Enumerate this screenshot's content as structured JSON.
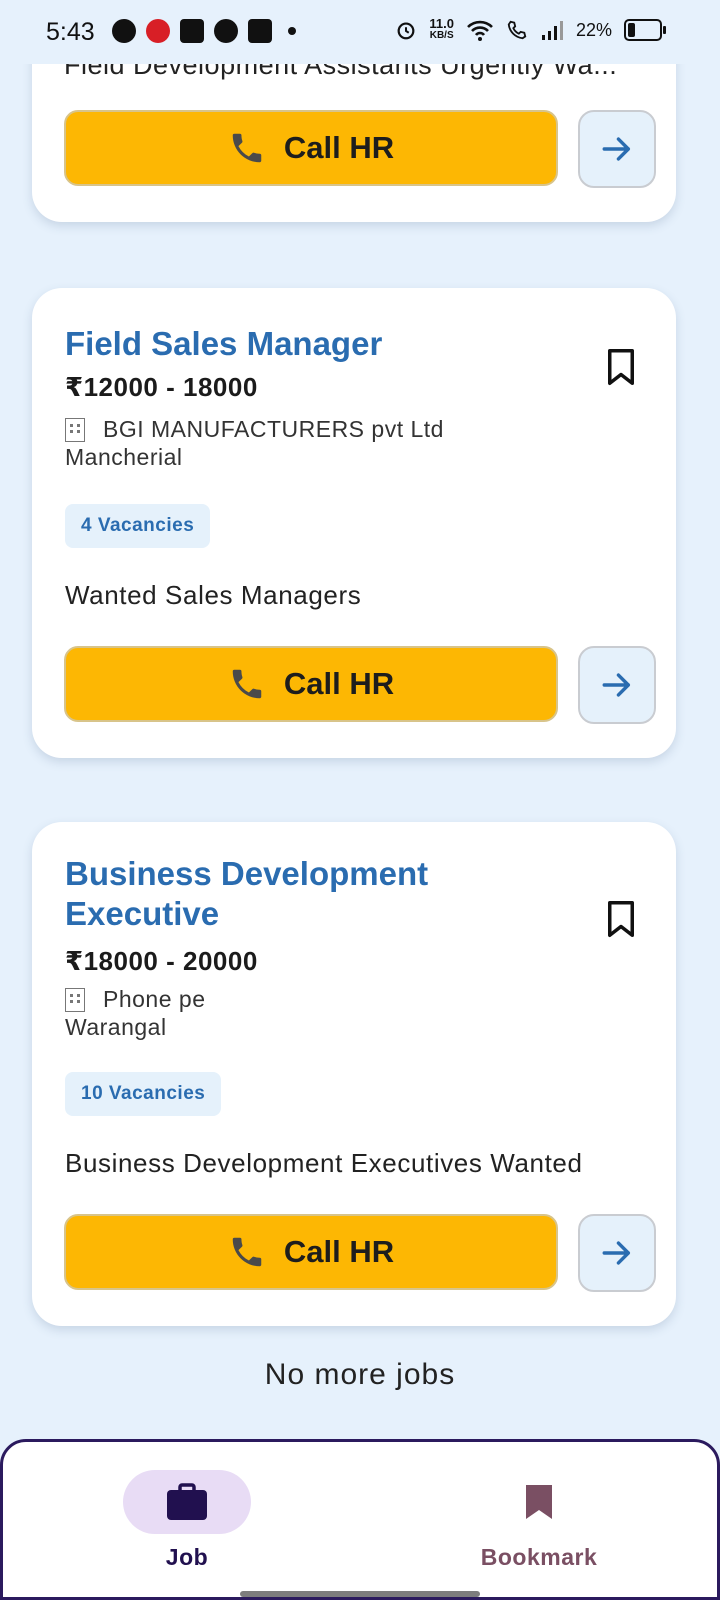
{
  "status_bar": {
    "time": "5:43",
    "speed_value": "11.0",
    "speed_unit": "KB/S",
    "battery": "22%"
  },
  "jobs": [
    {
      "title_partial": "Field Development Assistants Urgently Wa...",
      "call_label": "Call HR"
    },
    {
      "title": "Field Sales Manager",
      "salary": "₹12000 - 18000",
      "company": "BGI MANUFACTURERS pvt Ltd",
      "location": "Mancherial",
      "vacancies": "4 Vacancies",
      "description": "Wanted Sales Managers",
      "call_label": "Call HR"
    },
    {
      "title": "Business Development Executive",
      "salary": "₹18000 - 20000",
      "company": "Phone pe",
      "location": "Warangal",
      "vacancies": "10 Vacancies",
      "description": "Business Development Executives Wanted",
      "call_label": "Call HR"
    }
  ],
  "end_message": "No more jobs",
  "nav": {
    "job_label": "Job",
    "bookmark_label": "Bookmark"
  },
  "colors": {
    "accent_blue": "#2a6cb0",
    "call_yellow": "#fdb703",
    "nav_active": "#21104f",
    "bookmark_nav": "#7a4f63"
  }
}
